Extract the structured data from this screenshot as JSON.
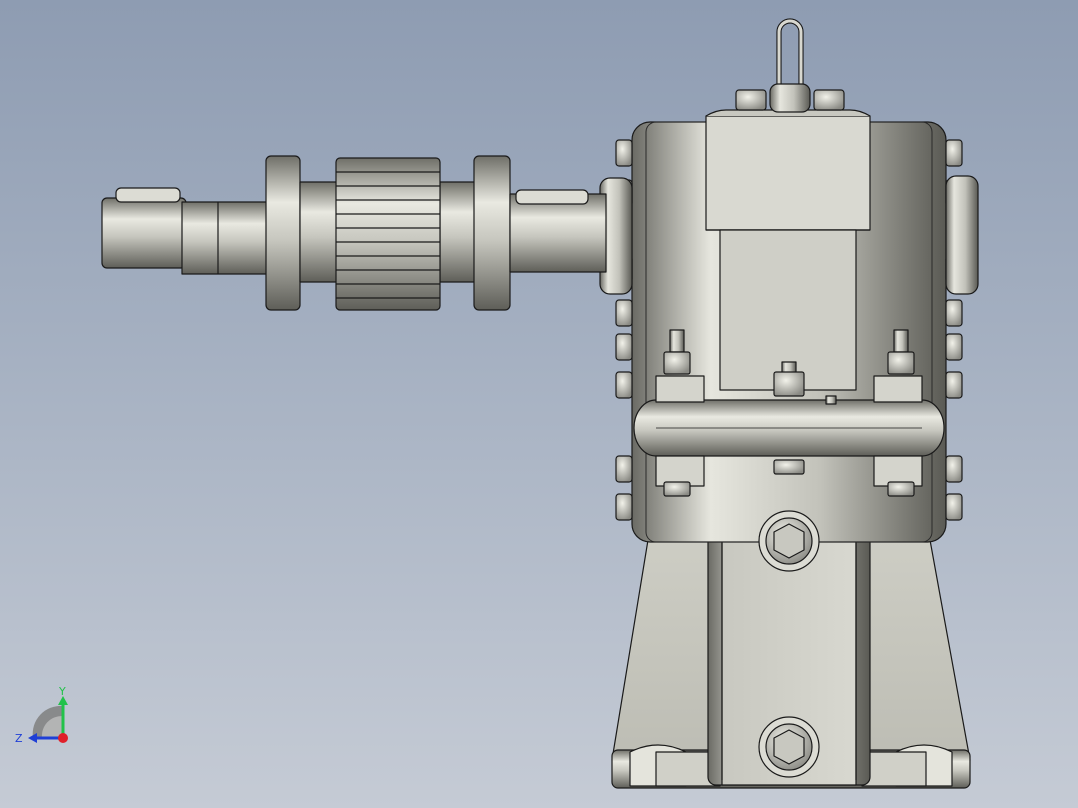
{
  "viewport": {
    "background_top": "#8e9cb2",
    "background_bottom": "#c5cbd5",
    "model_shade": "#cfcfc6",
    "model_edge": "#1a1a1a"
  },
  "triad": {
    "y_label": "Y",
    "z_label": "Z",
    "y_color": "#22c24a",
    "z_color": "#1f3fd6",
    "x_color": "#e0202a"
  }
}
